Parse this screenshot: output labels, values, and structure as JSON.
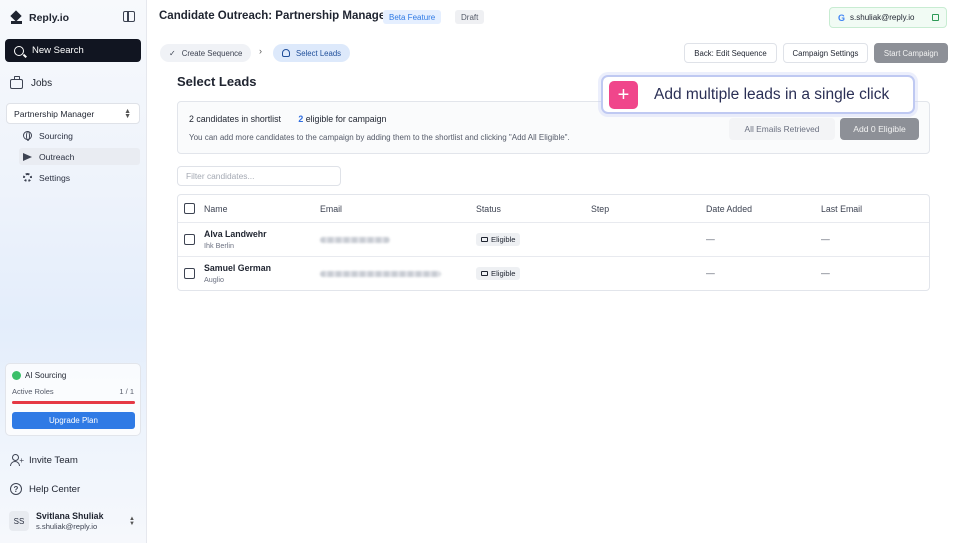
{
  "sidebar": {
    "brand": "Reply.io",
    "new_search": "New Search",
    "jobs": "Jobs",
    "job_selected": "Partnership Manager",
    "nav": [
      {
        "label": "Sourcing",
        "icon": "globe-icon"
      },
      {
        "label": "Outreach",
        "icon": "send-icon"
      },
      {
        "label": "Settings",
        "icon": "gear-icon"
      }
    ],
    "ai": {
      "title": "AI Sourcing",
      "roles_label": "Active Roles",
      "roles_count": "1 / 1",
      "usage_fraction": 1.0,
      "upgrade": "Upgrade Plan"
    },
    "invite": "Invite Team",
    "help": "Help Center",
    "user": {
      "initials": "SS",
      "name": "Svitlana Shuliak",
      "email": "s.shuliak@reply.io"
    }
  },
  "header": {
    "title": "Candidate Outreach: Partnership Manager",
    "beta": "Beta Feature",
    "draft": "Draft",
    "account": "s.shuliak@reply.io"
  },
  "breadcrumbs": [
    "Create Sequence",
    "Select Leads"
  ],
  "actions": {
    "back": "Back: Edit Sequence",
    "settings": "Campaign Settings",
    "start": "Start Campaign"
  },
  "section_title": "Select Leads",
  "info": {
    "shortlist_text": "2 candidates in shortlist",
    "eligible_num": "2",
    "eligible_text": "eligible for campaign",
    "description": "You can add more candidates to the campaign by adding them to the shortlist and clicking \"Add All Eligible\".",
    "retrieved": "All Emails Retrieved",
    "add_eligible": "Add 0 Eligible"
  },
  "callout": {
    "plus": "+",
    "text": "Add multiple leads in a single click"
  },
  "filter_placeholder": "Filter candidates...",
  "table": {
    "columns": [
      "Name",
      "Email",
      "Status",
      "Step",
      "Date Added",
      "Last Email"
    ],
    "rows": [
      {
        "name": "Alva Landwehr",
        "company": "Ihk Berlin",
        "status": "Eligible",
        "date_added": "—",
        "last_email": "—"
      },
      {
        "name": "Samuel German",
        "company": "Auglio",
        "status": "Eligible",
        "date_added": "—",
        "last_email": "—"
      }
    ]
  },
  "colors": {
    "accent": "#2f7ae5",
    "dark_button": "#111521",
    "callout_plus": "#f0468b",
    "progress": "#e53945"
  }
}
